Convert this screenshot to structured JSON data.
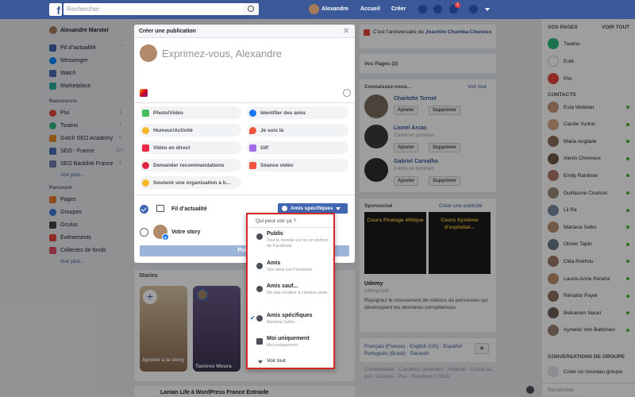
{
  "topbar": {
    "search_placeholder": "Rechercher",
    "user": "Alexandre",
    "home": "Accueil",
    "create": "Créer",
    "notif_count": "1"
  },
  "left": {
    "profile": "Alexandre Marotel",
    "items": [
      {
        "label": "Fil d’actualité",
        "more": "···"
      },
      {
        "label": "Messenger"
      },
      {
        "label": "Watch"
      },
      {
        "label": "Marketplace"
      }
    ],
    "shortcuts_title": "Raccourcis",
    "shortcuts": [
      {
        "label": "Pixi",
        "count": "1"
      },
      {
        "label": "Twaino",
        "count": "1"
      },
      {
        "label": "Gotch SEO Academy",
        "count": "9"
      },
      {
        "label": "SEO - France",
        "count": "20+"
      },
      {
        "label": "SEO Backlink France",
        "count": "1"
      }
    ],
    "seemore1": "Voir plus...",
    "explore_title": "Parcourir",
    "explore": [
      {
        "label": "Pages"
      },
      {
        "label": "Groupes"
      },
      {
        "label": "Oculus"
      },
      {
        "label": "Évènements"
      },
      {
        "label": "Collectes de fonds"
      }
    ],
    "seemore2": "Voir plus..."
  },
  "modal": {
    "title": "Créer une publication",
    "placeholder": "Exprimez-vous, Alexandre",
    "actions": [
      "Photo/Vidéo",
      "Identifier des amis",
      "Humeur/Activité",
      "Je suis là",
      "Vidéo en direct",
      "GIF",
      "Demander recommandations",
      "Séance vidéo",
      "Soutenir une organisation à b..."
    ],
    "feed_label": "Fil d’actualité",
    "story_label": "Votre story",
    "audience_button": "Amis spécifiques",
    "share_label": "Publi"
  },
  "dropdown": {
    "header": "Qui peut voir ça ?",
    "options": [
      {
        "title": "Public",
        "sub": "Tout le monde sur ou en dehors de Facebook"
      },
      {
        "title": "Amis",
        "sub": "Vos amis sur Facebook"
      },
      {
        "title": "Amis sauf...",
        "sub": "Ne pas montrer à certains amis"
      },
      {
        "title": "Amis spécifiques",
        "sub": "Mariana Selko"
      },
      {
        "title": "Moi uniquement",
        "sub": "Moi uniquement"
      }
    ],
    "see_all": "Voir tout"
  },
  "stories": {
    "title": "Stories",
    "add": "Ajouter à la story",
    "person": "Tamires Moura"
  },
  "post_preview": "Lanian Life à WordPress France Entraide",
  "mid_right": {
    "birthday_prefix": "C’est l’anniversaire de ",
    "birthday_name": "Joachim Chamba-Cheneux",
    "pages_title": "Vos Pages (2)",
    "pymk_title": "Connaissez-vous...",
    "see_all": "Voir tout",
    "people": [
      {
        "name": "Charlotte Ternet",
        "mutual": "",
        "add": "Ajouter",
        "remove": "Supprimer"
      },
      {
        "name": "Lionel Arcac",
        "mutual": "3 amis en commun",
        "add": "Ajouter",
        "remove": "Supprimer"
      },
      {
        "name": "Gabriel Carvalho",
        "mutual": "3 amis en commun",
        "add": "Ajouter",
        "remove": "Supprimer"
      }
    ],
    "sponsored_title": "Sponsorisé",
    "create_ad": "Créer une publicité",
    "ad1": "Cours Piratage éthique",
    "ad2": "Cours Système d’exploitat...",
    "ad_name": "Udemy",
    "ad_url": "udemy.com",
    "ad_text": "Rejoignez le mouvement de millions de personnes qui développent les dernières compétences.",
    "languages": "Français (France) · English (US) · Español · Português (Brasil) · Deutsch",
    "footer": "Confidentialité · Conditions générales · Publicité · Choisir sa pub · Cookies · Plus · Facebook © 2019"
  },
  "right": {
    "pages_title": "VOS PAGES",
    "see_all": "VOIR TOUT",
    "pages": [
      "Twaino",
      "Eolé",
      "Pixi"
    ],
    "contacts_title": "CONTACTS",
    "contacts": [
      "Esta Webster",
      "Carole Yurinic",
      "Marie Anglade",
      "Alexis Chevreux",
      "Emily Rainbow",
      "Guillaume Courtois",
      "Lil Ra",
      "Mariana Selko",
      "Olivier Tapin",
      "Cléa Rekhou",
      "Laurie-Anne Pereira",
      "Rénaldo Payet",
      "Belkacem Nacer",
      "Aymeric Von Baltoniev"
    ],
    "group_title": "CONVERSATIONS DE GROUPE",
    "new_group": "Créer un nouveau groupe",
    "search": "Rechercher"
  },
  "colors": {
    "topbar": "#3b5998",
    "accent": "#4267b2",
    "highlight": "#d72828"
  }
}
